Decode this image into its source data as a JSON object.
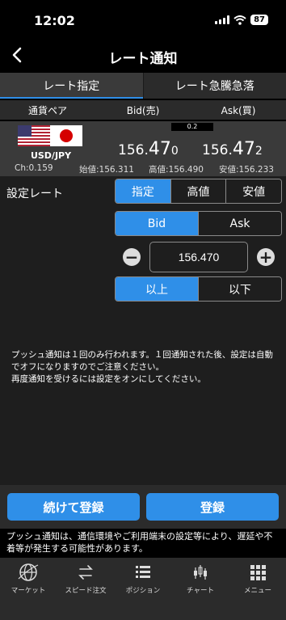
{
  "status": {
    "time": "12:02",
    "battery": "87"
  },
  "nav": {
    "title": "レート通知"
  },
  "tabs": [
    {
      "label": "レート指定",
      "active": true
    },
    {
      "label": "レート急騰急落",
      "active": false
    }
  ],
  "columns": {
    "pair": "通貨ペア",
    "bid": "Bid(売)",
    "ask": "Ask(買)"
  },
  "quote": {
    "pair": "USD/JPY",
    "spread": "0.2",
    "bid": {
      "lo": "156.",
      "hi": "47",
      "pip": "0"
    },
    "ask": {
      "lo": "156.",
      "hi": "47",
      "pip": "2"
    },
    "change": "Ch:0.159",
    "open": "始値:156.311",
    "high": "高値:156.490",
    "low": "安値:156.233"
  },
  "form": {
    "setting_label": "設定レート",
    "rate_type": {
      "options": [
        "指定",
        "高値",
        "安値"
      ],
      "selected": "指定"
    },
    "side": {
      "options": [
        "Bid",
        "Ask"
      ],
      "selected": "Bid"
    },
    "rate_value": "156.470",
    "minus": "−",
    "plus": "+",
    "condition": {
      "options": [
        "以上",
        "以下"
      ],
      "selected": "以上"
    },
    "note": "プッシュ通知は１回のみ行われます。１回通知された後、設定は自動でオフになりますのでご注意ください。\n再度通知を受けるには設定をオンにしてください。"
  },
  "actions": {
    "continue_label": "続けて登録",
    "register_label": "登録"
  },
  "footer_note": "プッシュ通知は、通信環境やご利用端末の設定等により、遅延や不着等が発生する可能性があります。",
  "bottom_nav": [
    {
      "label": "マーケット",
      "icon": "globe-icon"
    },
    {
      "label": "スピード注文",
      "icon": "speed-order-icon"
    },
    {
      "label": "ポジション",
      "icon": "list-icon"
    },
    {
      "label": "チャート",
      "icon": "candlestick-icon"
    },
    {
      "label": "メニュー",
      "icon": "grid-menu-icon"
    }
  ],
  "colors": {
    "accent": "#2f8fe8",
    "panel": "#3a3a3a",
    "background": "#1e1e1e"
  }
}
